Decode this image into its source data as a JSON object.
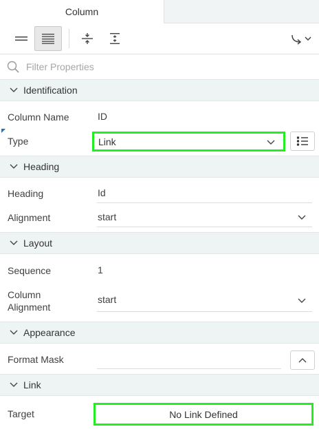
{
  "tabs": [
    {
      "label": "Column"
    }
  ],
  "toolbar": {
    "buttons": [
      {
        "icon": "collapse-lines-icon"
      },
      {
        "icon": "expand-lines-icon"
      },
      {
        "icon": "collapse-all-icon"
      },
      {
        "icon": "expand-all-icon"
      },
      {
        "icon": "goto-menu-icon"
      }
    ]
  },
  "filter": {
    "placeholder": "Filter Properties"
  },
  "sections": {
    "identification": {
      "title": "Identification",
      "column_name_label": "Column Name",
      "column_name_value": "ID",
      "type_label": "Type",
      "type_value": "Link"
    },
    "heading": {
      "title": "Heading",
      "heading_label": "Heading",
      "heading_value": "Id",
      "alignment_label": "Alignment",
      "alignment_value": "start"
    },
    "layout": {
      "title": "Layout",
      "sequence_label": "Sequence",
      "sequence_value": "1",
      "column_alignment_label_line1": "Column",
      "column_alignment_label_line2": "Alignment",
      "column_alignment_value": "start"
    },
    "appearance": {
      "title": "Appearance",
      "format_mask_label": "Format Mask",
      "format_mask_value": ""
    },
    "link": {
      "title": "Link",
      "target_label": "Target",
      "target_value": "No Link Defined"
    }
  },
  "colors": {
    "highlight": "#22ee22",
    "section_bg": "#eef3f3",
    "corner_marker": "#2a6fb0"
  }
}
